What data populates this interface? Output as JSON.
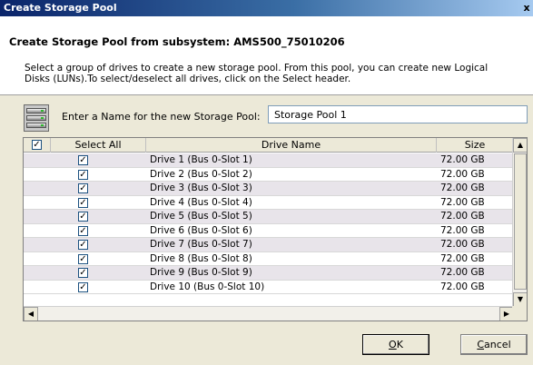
{
  "window": {
    "title": "Create Storage Pool",
    "close_glyph": "x"
  },
  "header": {
    "title": "Create Storage Pool from subsystem: AMS500_75010206",
    "description": "Select a group of drives to create a new storage pool. From this pool, you can create new Logical Disks (LUNs).To select/deselect all drives, click on the Select header."
  },
  "name_field": {
    "label": "Enter a Name for the new Storage Pool:",
    "value": "Storage Pool 1",
    "icon": "storage-pool-icon"
  },
  "grid": {
    "columns": {
      "select": "Select All",
      "name": "Drive Name",
      "size": "Size"
    },
    "select_all_checked": true,
    "rows": [
      {
        "checked": true,
        "name": "Drive 1 (Bus 0-Slot 1)",
        "size": "72.00 GB"
      },
      {
        "checked": true,
        "name": "Drive 2 (Bus 0-Slot 2)",
        "size": "72.00 GB"
      },
      {
        "checked": true,
        "name": "Drive 3 (Bus 0-Slot 3)",
        "size": "72.00 GB"
      },
      {
        "checked": true,
        "name": "Drive 4 (Bus 0-Slot 4)",
        "size": "72.00 GB"
      },
      {
        "checked": true,
        "name": "Drive 5 (Bus 0-Slot 5)",
        "size": "72.00 GB"
      },
      {
        "checked": true,
        "name": "Drive 6 (Bus 0-Slot 6)",
        "size": "72.00 GB"
      },
      {
        "checked": true,
        "name": "Drive 7 (Bus 0-Slot 7)",
        "size": "72.00 GB"
      },
      {
        "checked": true,
        "name": "Drive 8 (Bus 0-Slot 8)",
        "size": "72.00 GB"
      },
      {
        "checked": true,
        "name": "Drive 9 (Bus 0-Slot 9)",
        "size": "72.00 GB"
      },
      {
        "checked": true,
        "name": "Drive 10 (Bus 0-Slot 10)",
        "size": "72.00 GB"
      }
    ]
  },
  "buttons": {
    "ok_label": "OK",
    "ok_mnemonic": "O",
    "cancel_label": "Cancel",
    "cancel_mnemonic": "C"
  }
}
